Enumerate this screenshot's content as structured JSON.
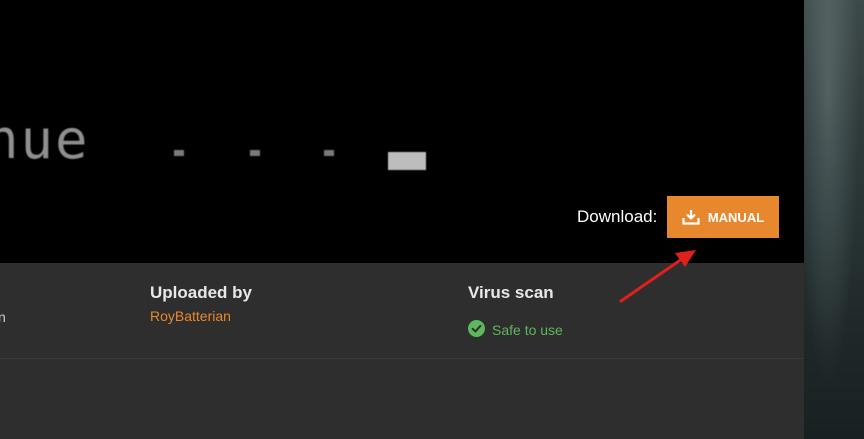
{
  "video": {
    "terminal_text": "nue"
  },
  "download": {
    "label": "Download:",
    "button_label": "MANUAL",
    "button_color": "#e8882e"
  },
  "info": {
    "left_fragment": "n",
    "uploaded_by_title": "Uploaded by",
    "uploader_name": "RoyBatterian",
    "virus_scan_title": "Virus scan",
    "virus_scan_status": "Safe to use",
    "status_color": "#5cb85c"
  },
  "annotation": {
    "arrow_color": "#e0201b"
  }
}
